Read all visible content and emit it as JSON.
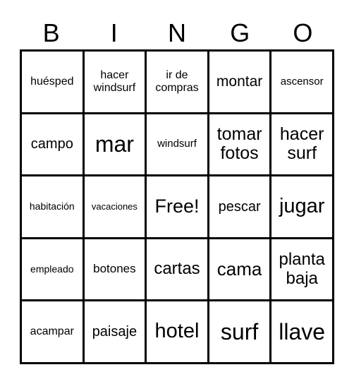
{
  "header": [
    "B",
    "I",
    "N",
    "G",
    "O"
  ],
  "cells": [
    {
      "text": "huésped",
      "size": 16
    },
    {
      "text": "hacer windsurf",
      "size": 16
    },
    {
      "text": "ir de compras",
      "size": 16
    },
    {
      "text": "montar",
      "size": 21
    },
    {
      "text": "ascensor",
      "size": 15
    },
    {
      "text": "campo",
      "size": 20
    },
    {
      "text": "mar",
      "size": 32
    },
    {
      "text": "windsurf",
      "size": 15
    },
    {
      "text": "tomar fotos",
      "size": 25
    },
    {
      "text": "hacer surf",
      "size": 25
    },
    {
      "text": "habitación",
      "size": 14
    },
    {
      "text": "vacaciones",
      "size": 13
    },
    {
      "text": "Free!",
      "size": 27
    },
    {
      "text": "pescar",
      "size": 20
    },
    {
      "text": "jugar",
      "size": 29
    },
    {
      "text": "empleado",
      "size": 14
    },
    {
      "text": "botones",
      "size": 17
    },
    {
      "text": "cartas",
      "size": 24
    },
    {
      "text": "cama",
      "size": 26
    },
    {
      "text": "planta baja",
      "size": 24
    },
    {
      "text": "acampar",
      "size": 16
    },
    {
      "text": "paisaje",
      "size": 20
    },
    {
      "text": "hotel",
      "size": 29
    },
    {
      "text": "surf",
      "size": 32
    },
    {
      "text": "llave",
      "size": 32
    }
  ]
}
